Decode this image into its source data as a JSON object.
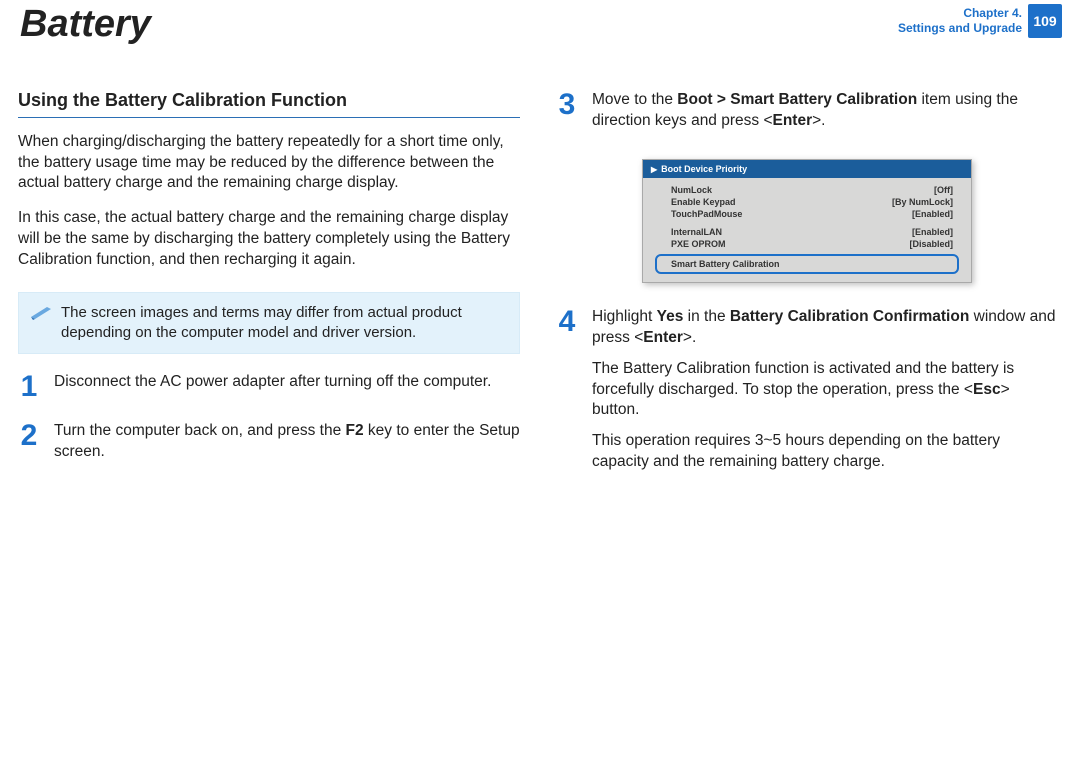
{
  "header": {
    "title": "Battery",
    "chapter_line1": "Chapter 4.",
    "chapter_line2": "Settings and Upgrade",
    "page_number": "109"
  },
  "left": {
    "heading": "Using the Battery Calibration Function",
    "p1": "When charging/discharging the battery repeatedly for a short time only, the battery usage time may be reduced by the difference between the actual battery charge and the remaining charge display.",
    "p2": "In this case, the actual battery charge and the remaining charge display will be the same by discharging the battery completely using the Battery Calibration function, and then recharging it again.",
    "note": "The screen images and terms may differ from actual product depending on the computer model and driver version.",
    "step1_num": "1",
    "step1": "Disconnect the AC power adapter after turning off the computer.",
    "step2_num": "2",
    "step2_a": "Turn the computer back on, and press the ",
    "step2_b": "F2",
    "step2_c": " key to enter the Setup screen."
  },
  "right": {
    "step3_num": "3",
    "step3_a": "Move to the ",
    "step3_b": "Boot > Smart Battery Calibration",
    "step3_c": " item using the direction keys and press <",
    "step3_d": "Enter",
    "step3_e": ">.",
    "bios": {
      "header": "Boot Device Priority",
      "rows": [
        {
          "k": "NumLock",
          "v": "[Off]"
        },
        {
          "k": "Enable Keypad",
          "v": "[By NumLock]"
        },
        {
          "k": "TouchPadMouse",
          "v": "[Enabled]"
        }
      ],
      "rows2": [
        {
          "k": "InternalLAN",
          "v": "[Enabled]"
        },
        {
          "k": "PXE OPROM",
          "v": "[Disabled]"
        }
      ],
      "highlight": "Smart Battery Calibration"
    },
    "step4_num": "4",
    "step4_a": "Highlight ",
    "step4_b": "Yes",
    "step4_c": " in the ",
    "step4_d": "Battery Calibration Confirmation",
    "step4_e": " window and press <",
    "step4_f": "Enter",
    "step4_g": ">.",
    "step4_p2a": "The Battery Calibration function is activated and the battery is forcefully discharged. To stop the operation, press the <",
    "step4_p2b": "Esc",
    "step4_p2c": "> button.",
    "step4_p3": "This operation requires 3~5 hours depending on the battery capacity and the remaining battery charge."
  }
}
